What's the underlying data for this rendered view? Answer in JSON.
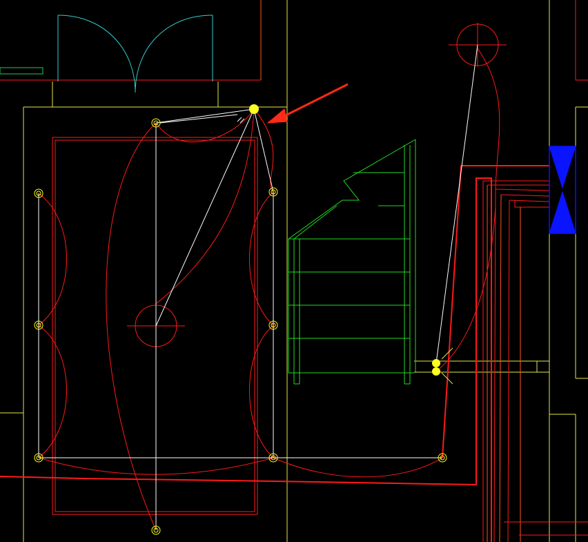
{
  "view": {
    "kind": "CAD lighting / wiring floor plan",
    "background": "#000000"
  },
  "colors": {
    "wall": "#e8e84a",
    "wiring": "#ff1a1a",
    "wiring_thick": "#ff2a2a",
    "wiring_orange": "#ff5522",
    "connection": "#ffffff",
    "door_arc": "#2fd0d0",
    "stair": "#22dd22",
    "selection_grip": "#ffff22",
    "panel": "#0a14ff",
    "arrow": "#ff2a1a",
    "small_bar": "#22cc55"
  },
  "icons": {
    "lamp_points": "circle-point-icon",
    "ceiling_light": "ceiling-light-icon",
    "grip": "selection-grip-icon",
    "panel": "distribution-panel-icon",
    "arrow": "pointer-arrow-icon"
  }
}
